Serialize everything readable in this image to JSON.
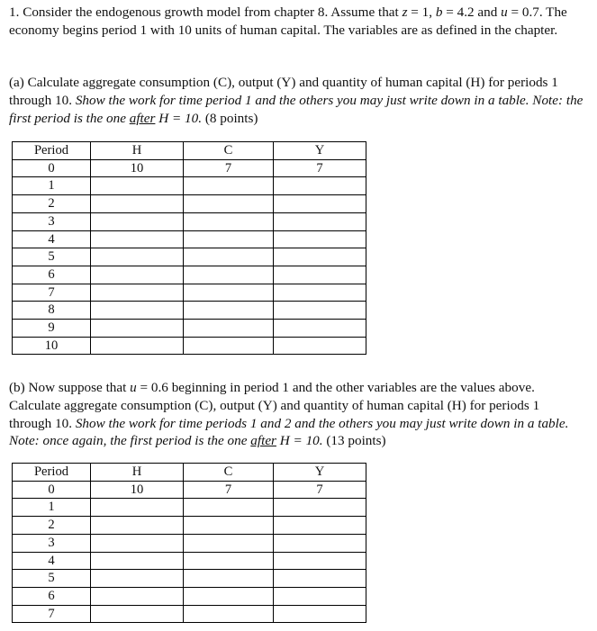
{
  "document": {
    "type": "problem-set",
    "background_color": "#ffffff",
    "text_color": "#101010"
  },
  "question_intro": {
    "number": "1.",
    "text_before_z": " Consider the endogenous growth model from chapter 8. Assume that ",
    "var_z": "z",
    "eq_z": " = 1, ",
    "var_b": "b",
    "eq_b": " = 4.2 and ",
    "var_u": "u",
    "eq_u": " = 0.7. The economy begins period 1 with 10 units of human capital. The variables are as defined in the chapter."
  },
  "part_a": {
    "label": "(a)",
    "text_1": " Calculate aggregate consumption (C), output (Y) and quantity of human capital (H) for periods 1 through 10. ",
    "italic_1": "Show the work for time period 1 and the others you may just write down in a table. Note: the first period is the one ",
    "underlined": "after",
    "italic_2": " H = 10.",
    "points": " (8 points)"
  },
  "part_b": {
    "label": "(b)",
    "text_1": " Now suppose that ",
    "var_u": "u",
    "text_2": " = 0.6 beginning in period 1 and the other variables are the values above. Calculate aggregate consumption (C), output (Y) and quantity of human capital (H) for periods 1 through 10. ",
    "italic_1": "Show the work for time periods 1 and 2 and the others you may just write down in a table. Note: once again, the first period is the one ",
    "underlined": "after",
    "italic_2": " H = 10.",
    "points": " (13 points)"
  },
  "table_a": {
    "headers": [
      "Period",
      "H",
      "C",
      "Y"
    ],
    "rows": [
      [
        "0",
        "10",
        "7",
        "7"
      ],
      [
        "1",
        "",
        "",
        ""
      ],
      [
        "2",
        "",
        "",
        ""
      ],
      [
        "3",
        "",
        "",
        ""
      ],
      [
        "4",
        "",
        "",
        ""
      ],
      [
        "5",
        "",
        "",
        ""
      ],
      [
        "6",
        "",
        "",
        ""
      ],
      [
        "7",
        "",
        "",
        ""
      ],
      [
        "8",
        "",
        "",
        ""
      ],
      [
        "9",
        "",
        "",
        ""
      ],
      [
        "10",
        "",
        "",
        ""
      ]
    ]
  },
  "table_b": {
    "headers": [
      "Period",
      "H",
      "C",
      "Y"
    ],
    "rows": [
      [
        "0",
        "10",
        "7",
        "7"
      ],
      [
        "1",
        "",
        "",
        ""
      ],
      [
        "2",
        "",
        "",
        ""
      ],
      [
        "3",
        "",
        "",
        ""
      ],
      [
        "4",
        "",
        "",
        ""
      ],
      [
        "5",
        "",
        "",
        ""
      ],
      [
        "6",
        "",
        "",
        ""
      ],
      [
        "7",
        "",
        "",
        ""
      ]
    ]
  }
}
